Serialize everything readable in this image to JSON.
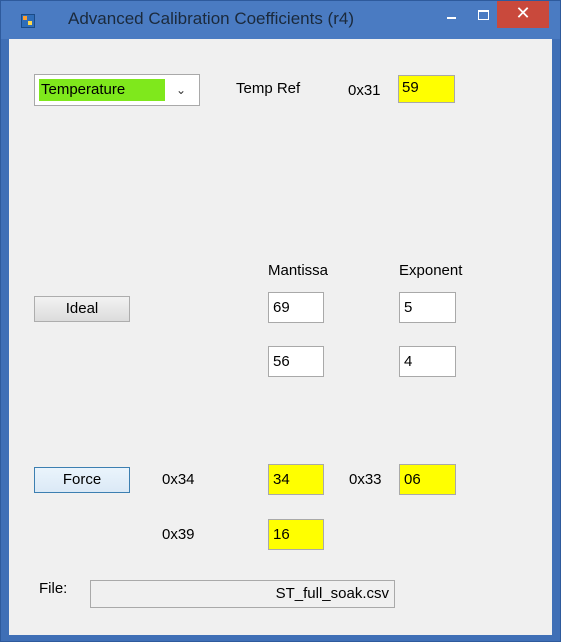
{
  "window": {
    "title": "Advanced Calibration Coefficients (r4)",
    "close_glyph": "✕",
    "icons": {
      "app": "app-icon",
      "minimize": "minimize-icon",
      "maximize": "maximize-icon",
      "close": "close-icon"
    }
  },
  "colors": {
    "titlebar": "#4a7bc2",
    "client_bg": "#f0f0f0",
    "close_button": "#c9493c",
    "highlight_yellow": "#ffff00",
    "combo_highlight_green": "#7fe81c"
  },
  "sensor_select": {
    "value": "Temperature",
    "arrow_icon": "chevron-down-icon"
  },
  "temp_ref": {
    "label": "Temp Ref",
    "address": "0x31",
    "value": "59"
  },
  "coefficients": {
    "mantissa_header": "Mantissa",
    "exponent_header": "Exponent",
    "rows": [
      {
        "mantissa": "69",
        "exponent": "5"
      },
      {
        "mantissa": "56",
        "exponent": "4"
      }
    ]
  },
  "ideal_button": {
    "label": "Ideal"
  },
  "force": {
    "button_label": "Force",
    "address_a": "0x34",
    "value_a": "34",
    "address_b": "0x33",
    "value_b": "06",
    "address_c": "0x39",
    "value_c": "16"
  },
  "file": {
    "label": "File:",
    "value": "ST_full_soak.csv"
  }
}
